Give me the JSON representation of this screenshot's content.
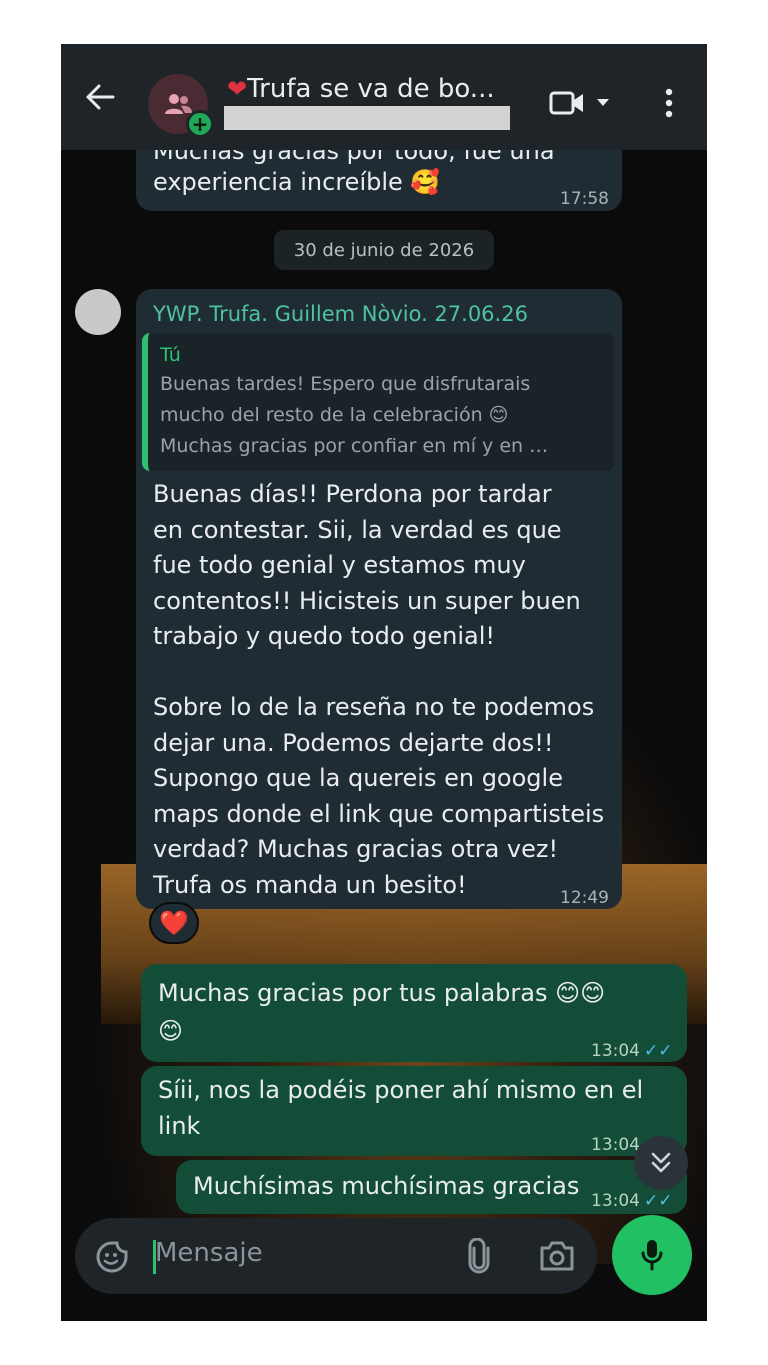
{
  "header": {
    "title": "Trufa se va de bo...",
    "title_emoji": "❤",
    "back_icon": "arrow-left-icon",
    "avatar_icon": "group-icon",
    "video_icon": "video-call-icon",
    "menu_icon": "more-vertical-icon"
  },
  "messages": {
    "prev": {
      "text_partial": "Muchas gracias por todo, fue una",
      "text": "experiencia increíble 🥰",
      "time": "17:58"
    },
    "date_chip": "30 de junio de 2026",
    "incoming": {
      "sender": "YWP. Trufa. Guillem Nòvio. 27.06.26",
      "quote_author": "Tú",
      "quote_text": "Buenas tardes! Espero que disfrutarais\nmucho del resto de la celebración 😊\nMuchas gracias por confiar en mí y en …",
      "text": "Buenas días!! Perdona por tardar\nen contestar. Sii, la verdad es que\nfue todo genial y estamos muy\ncontentos!! Hicisteis un super buen\ntrabajo y quedo todo genial!\n\nSobre lo de la reseña no te podemos\ndejar una. Podemos dejarte dos!!\nSupongo que la quereis en google\nmaps donde el link que compartisteis\nverdad? Muchas gracias otra vez!\nTrufa os manda un besito!",
      "time": "12:49",
      "reaction": "❤️"
    },
    "out1": {
      "text": "Muchas gracias por tus palabras 😊😊\n😊",
      "time": "13:04"
    },
    "out2": {
      "text": "Síii, nos la podéis poner ahí mismo en el\nlink",
      "time": "13:04"
    },
    "out3": {
      "text": "Muchísimas muchísimas gracias",
      "time": "13:04"
    }
  },
  "composer": {
    "placeholder": "Mensaje",
    "sticker_icon": "sticker-icon",
    "attach_icon": "paperclip-icon",
    "camera_icon": "camera-icon",
    "mic_icon": "microphone-icon"
  },
  "colors": {
    "incoming_bubble": "#202c33",
    "outgoing_bubble": "#144d37",
    "accent_green": "#21c063",
    "read_ticks": "#53bdeb"
  }
}
